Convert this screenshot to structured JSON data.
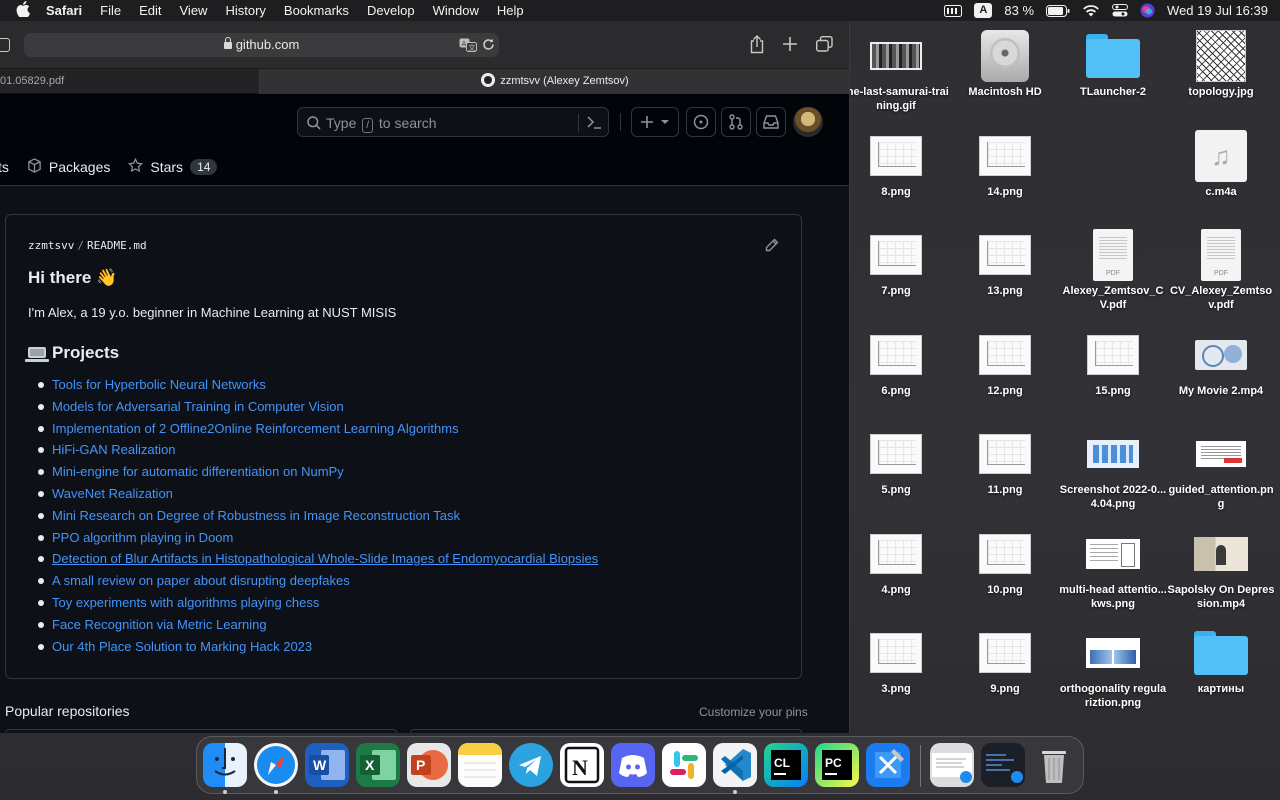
{
  "menubar": {
    "app_name": "Safari",
    "menus": [
      "File",
      "Edit",
      "View",
      "History",
      "Bookmarks",
      "Develop",
      "Window",
      "Help"
    ],
    "input_source": "A",
    "battery_percent": "83 %",
    "datetime": "Wed 19 Jul  16:39"
  },
  "safari": {
    "url": "github.com",
    "tabs": [
      {
        "title": "01.05829.pdf",
        "active": false
      },
      {
        "title": "zzmtsvv (Alexey Zemtsov)",
        "active": true
      }
    ]
  },
  "github": {
    "search_prefix": "Type",
    "search_key": "/",
    "search_suffix": "to search",
    "nav": [
      {
        "label": "ts"
      },
      {
        "label": "Packages"
      },
      {
        "label": "Stars",
        "count": "14"
      }
    ],
    "readme": {
      "owner": "zzmtsvv",
      "separator": "/",
      "file": "README.md",
      "greeting": "Hi there 👋",
      "intro": "I'm Alex, a 19 y.o. beginner in Machine Learning at NUST MISIS",
      "projects_heading": "Projects",
      "projects": [
        "Tools for Hyperbolic Neural Networks",
        "Models for Adversarial Training in Computer Vision",
        "Implementation of 2 Offline2Online Reinforcement Learning Algorithms",
        "HiFi-GAN Realization",
        "Mini-engine for automatic differentiation on NumPy",
        "WaveNet Realization",
        "Mini Research on Degree of Robustness in Image Reconstruction Task",
        "PPO algorithm playing in Doom",
        "Detection of Blur Artifacts in Histopathological Whole-Slide Images of Endomyocardial Biopsies",
        "A small review on paper about disrupting deepfakes",
        "Toy experiments with algorithms playing chess",
        "Face Recognition via Metric Learning",
        "Our 4th Place Solution to Marking Hack 2023"
      ]
    },
    "popular_heading": "Popular repositories",
    "customize_link": "Customize your pins"
  },
  "desktop": {
    "files": [
      {
        "name": "the-last-samurai-training.gif",
        "kind": "gif"
      },
      {
        "name": "Macintosh HD",
        "kind": "disk"
      },
      {
        "name": "TLauncher-2",
        "kind": "folder"
      },
      {
        "name": "topology.jpg",
        "kind": "image"
      },
      {
        "name": "8.png",
        "kind": "png"
      },
      {
        "name": "14.png",
        "kind": "png"
      },
      {
        "name": "c.m4a",
        "kind": "audio"
      },
      {
        "name": "7.png",
        "kind": "png"
      },
      {
        "name": "13.png",
        "kind": "png"
      },
      {
        "name": "Alexey_Zemtsov_CV.pdf",
        "kind": "pdf"
      },
      {
        "name": "CV_Alexey_Zemtsov.pdf",
        "kind": "pdf"
      },
      {
        "name": "6.png",
        "kind": "png"
      },
      {
        "name": "12.png",
        "kind": "png"
      },
      {
        "name": "15.png",
        "kind": "png"
      },
      {
        "name": "My Movie 2.mp4",
        "kind": "video"
      },
      {
        "name": "5.png",
        "kind": "png"
      },
      {
        "name": "11.png",
        "kind": "png"
      },
      {
        "name": "Screenshot 2022-0...4.04.png",
        "kind": "screenshot"
      },
      {
        "name": "guided_attention.png",
        "kind": "doc"
      },
      {
        "name": "4.png",
        "kind": "png"
      },
      {
        "name": "10.png",
        "kind": "png"
      },
      {
        "name": "multi-head attentio...kws.png",
        "kind": "figure"
      },
      {
        "name": "Sapolsky On Depression.mp4",
        "kind": "video"
      },
      {
        "name": "3.png",
        "kind": "png"
      },
      {
        "name": "9.png",
        "kind": "png"
      },
      {
        "name": "orthogonality regulariztion.png",
        "kind": "figure"
      },
      {
        "name": "картины",
        "kind": "folder"
      }
    ],
    "pdf_tag": "PDF",
    "audio_glyph": "♫"
  },
  "dock": {
    "apps": [
      "finder-icon",
      "safari-icon",
      "word-icon",
      "excel-icon",
      "powerpoint-icon",
      "notes-icon",
      "telegram-icon",
      "notion-icon",
      "discord-icon",
      "slack-icon",
      "vscode-icon",
      "clion-icon",
      "pycharm-icon",
      "xcode-icon",
      "preview-window-icon",
      "terminal-window-icon",
      "trash-icon"
    ],
    "letters": {
      "word": "W",
      "excel": "X",
      "powerpoint": "P",
      "notion": "N",
      "clion": "CL",
      "pycharm": "PC"
    }
  }
}
